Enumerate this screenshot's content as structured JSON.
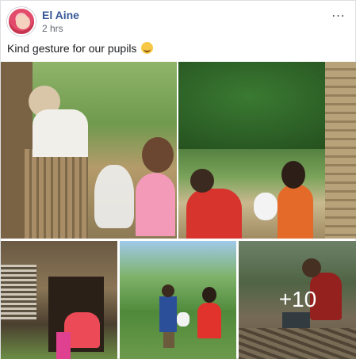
{
  "post": {
    "author": "El Aine",
    "timestamp": "2 hrs",
    "more_icon": "…",
    "caption": "Kind gesture for our pupils"
  },
  "photos": {
    "extra_count": "+10"
  }
}
